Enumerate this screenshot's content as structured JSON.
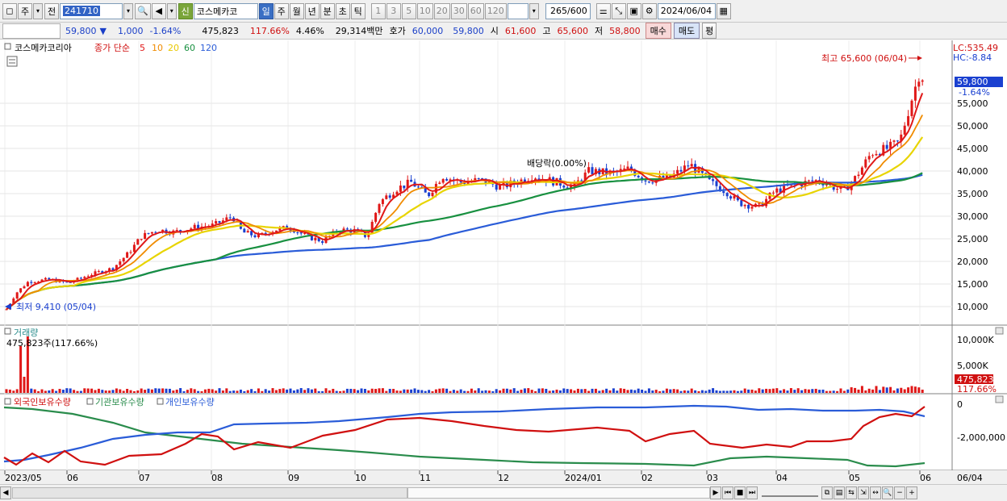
{
  "toolbar": {
    "radio_weekly": "주",
    "prev_label": "전",
    "code": "241710",
    "stock_name": "코스메카코",
    "new_badge": "신",
    "periods": [
      "일",
      "주",
      "월",
      "년",
      "분",
      "초",
      "틱"
    ],
    "active_period": "일",
    "intervals": [
      "1",
      "3",
      "5",
      "10",
      "20",
      "30",
      "60",
      "120"
    ],
    "count": "265",
    "count_total": "/600",
    "date": "2024/06/04"
  },
  "quote": {
    "price": "59,800",
    "change_arrow": "▼",
    "change": "1,000",
    "change_pct": "-1.64%",
    "volume": "475,823",
    "volume_ratio": "117.66%",
    "turnover_rate": "4.46%",
    "amount": "29,314백만",
    "hoga_label": "호가",
    "ask": "60,000",
    "bid": "59,800",
    "open_label": "시",
    "open": "61,600",
    "high_label": "고",
    "high": "65,600",
    "low_label": "저",
    "low": "58,800",
    "buy_button": "매수",
    "sell_button": "매도",
    "eval_button": "평"
  },
  "price_panel": {
    "name": "코스메카코리아",
    "ma_legend_label": "종가 단순",
    "ma_legend": [
      {
        "period": "5",
        "color": "#e01818"
      },
      {
        "period": "10",
        "color": "#f08c00"
      },
      {
        "period": "20",
        "color": "#e8d400"
      },
      {
        "period": "60",
        "color": "#189040"
      },
      {
        "period": "120",
        "color": "#2a5cd8"
      }
    ],
    "max_label": "최고 65,600 (06/04)",
    "min_label": "최저 9,410 (05/04)",
    "dividend_label": "배당락(0.00%)",
    "lc_label": "LC:535.49",
    "hc_label": "HC:-8.84",
    "current_price_tag": "59,800",
    "current_change_tag": "-1.64%",
    "y_ticks": [
      "55,000",
      "50,000",
      "45,000",
      "40,000",
      "35,000",
      "30,000",
      "25,000",
      "20,000",
      "15,000",
      "10,000"
    ]
  },
  "volume_panel": {
    "title": "거래량",
    "info": "475,823주(117.66%)",
    "y_ticks": [
      "10,000K",
      "5,000K"
    ],
    "current_tag": "475,823",
    "current_ratio_tag": "117.66%"
  },
  "holding_panel": {
    "legend": [
      {
        "label": "외국인보유수량",
        "color": "#d01010"
      },
      {
        "label": "기관보유수량",
        "color": "#2a8c4c"
      },
      {
        "label": "개인보유수량",
        "color": "#2a5cd8"
      }
    ],
    "y_ticks": [
      "0",
      "-2,000,000"
    ]
  },
  "x_axis": {
    "labels": [
      "2023/05",
      "06",
      "07",
      "08",
      "09",
      "10",
      "11",
      "12",
      "2024/01",
      "02",
      "03",
      "04",
      "05",
      "06"
    ],
    "right_date": "06/04"
  },
  "colors": {
    "up": "#e01818",
    "down": "#1a40d0",
    "price_tag_bg": "#1a40d0",
    "volume_tag_bg": "#d01010"
  }
}
